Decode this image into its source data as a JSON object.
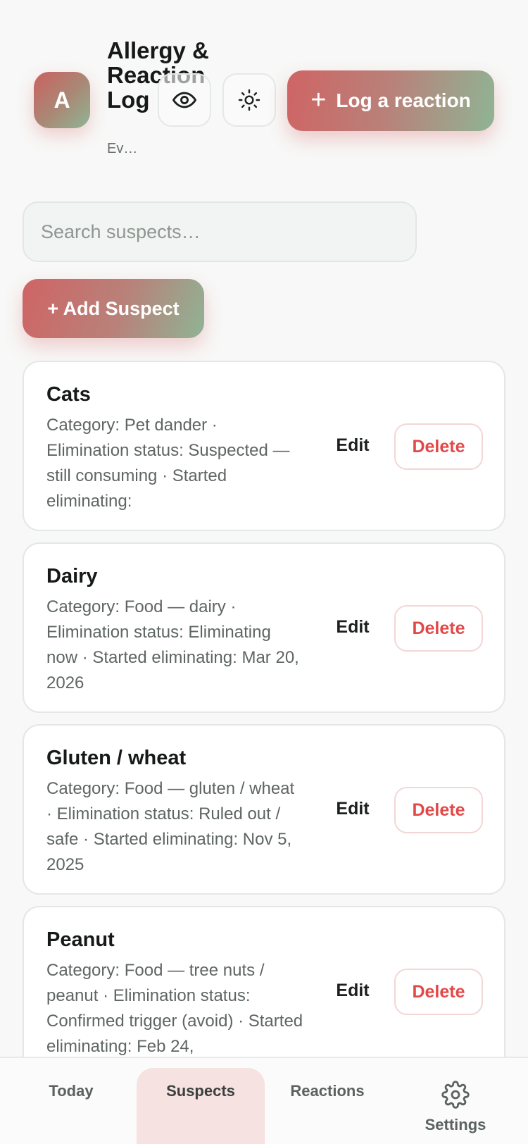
{
  "header": {
    "logo_letter": "A",
    "title": "Allergy & Reaction Log",
    "subtitle": "Ev…",
    "log_button_label": "Log a reaction",
    "log_button_icon": "plus-icon",
    "privacy_icon": "eye-icon",
    "theme_icon": "sun-icon"
  },
  "search": {
    "placeholder": "Search suspects…"
  },
  "add_button_label": "+ Add Suspect",
  "suspects": [
    {
      "name": "Cats",
      "description": "Category: Pet dander · Elimination status: Suspected — still consuming · Started eliminating:",
      "edit_label": "Edit",
      "delete_label": "Delete"
    },
    {
      "name": "Dairy",
      "description": "Category: Food — dairy · Elimination status: Eliminating now · Started eliminating: Mar 20, 2026",
      "edit_label": "Edit",
      "delete_label": "Delete"
    },
    {
      "name": "Gluten / wheat",
      "description": "Category: Food — gluten / wheat · Elimination status: Ruled out / safe · Started eliminating: Nov 5, 2025",
      "edit_label": "Edit",
      "delete_label": "Delete"
    },
    {
      "name": "Peanut",
      "description": "Category: Food — tree nuts / peanut · Elimination status: Confirmed trigger (avoid) · Started eliminating: Feb 24,",
      "edit_label": "Edit",
      "delete_label": "Delete"
    }
  ],
  "nav": {
    "today": "Today",
    "suspects": "Suspects",
    "reactions": "Reactions",
    "settings": "Settings",
    "settings_icon": "gear-icon",
    "active": "suspects"
  },
  "colors": {
    "accent_red": "#cf6464",
    "accent_green": "#8fb494",
    "delete_red": "#e34848",
    "active_tab_bg": "#f5e2e1"
  }
}
